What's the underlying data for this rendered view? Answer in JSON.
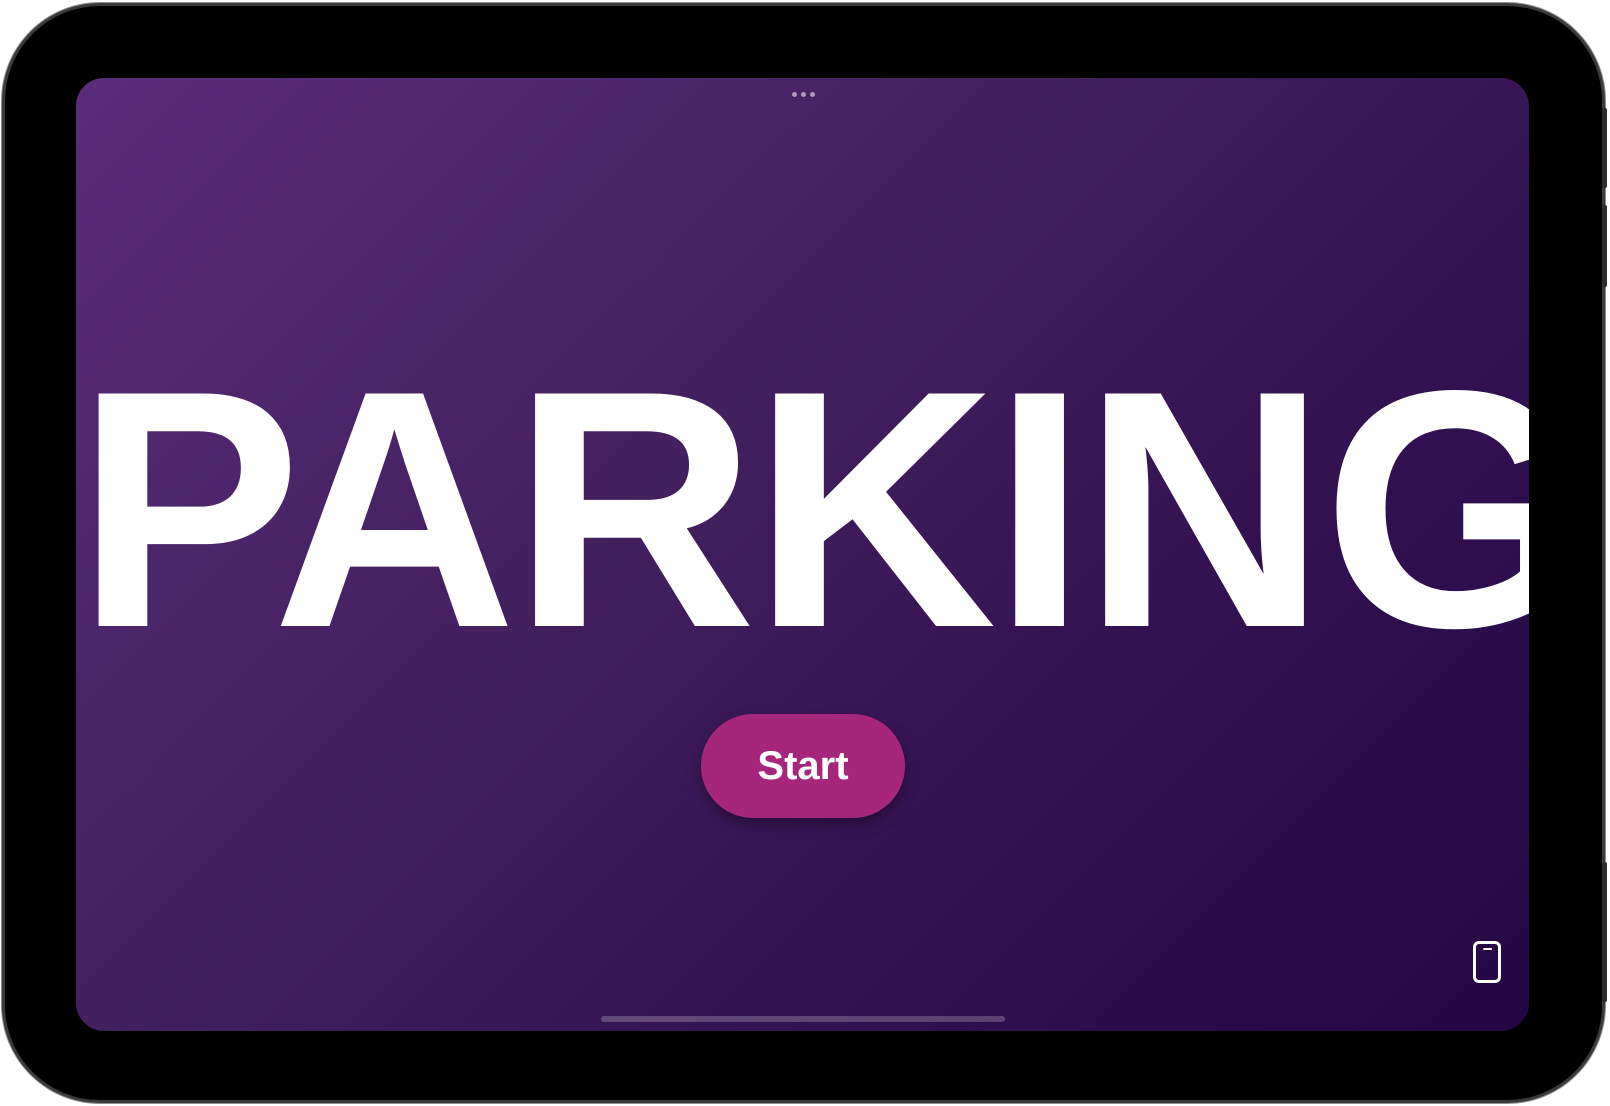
{
  "app": {
    "title": "PARKING",
    "start_button_label": "Start"
  },
  "icons": {
    "multitask": "ellipsis-icon",
    "device_toggle": "ipad-icon"
  },
  "colors": {
    "background_gradient_start": "#5a2c7a",
    "background_gradient_end": "#240744",
    "start_button": "#a5267a",
    "title_text": "#ffffff"
  }
}
